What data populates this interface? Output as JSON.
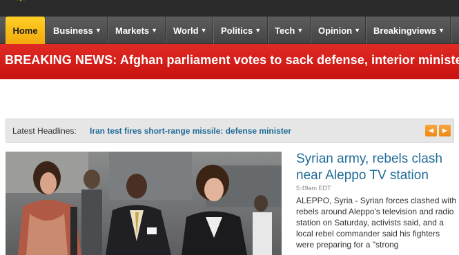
{
  "nav": {
    "items": [
      {
        "label": "Home",
        "has_dropdown": false,
        "active": true
      },
      {
        "label": "Business",
        "has_dropdown": true,
        "active": false
      },
      {
        "label": "Markets",
        "has_dropdown": true,
        "active": false
      },
      {
        "label": "World",
        "has_dropdown": true,
        "active": false
      },
      {
        "label": "Politics",
        "has_dropdown": true,
        "active": false
      },
      {
        "label": "Tech",
        "has_dropdown": true,
        "active": false
      },
      {
        "label": "Opinion",
        "has_dropdown": true,
        "active": false
      },
      {
        "label": "Breakingviews",
        "has_dropdown": true,
        "active": false
      }
    ],
    "caret_icon": "chevron-down-icon"
  },
  "breaking": {
    "label": "BREAKING NEWS:",
    "headline": "Afghan parliament votes to sack defense, interior ministers ma"
  },
  "ticker": {
    "label": "Latest Headlines:",
    "headline": "Iran test fires short-range missile: defense minister",
    "prev_icon": "chevron-left-icon",
    "next_icon": "chevron-right-icon",
    "button_color": "#f0921a"
  },
  "story": {
    "title": "Syrian army, rebels clash near Aleppo TV station",
    "time": "5:49am EDT",
    "body": "ALEPPO, Syria - Syrian forces clashed with rebels around Aleppo's television and radio station on Saturday, activists said, and a local rebel commander said his fighters were preparing for a \"strong"
  },
  "colors": {
    "nav_active": "#f5b416",
    "breaking_red": "#d41c18",
    "link_blue": "#1f6b97"
  }
}
